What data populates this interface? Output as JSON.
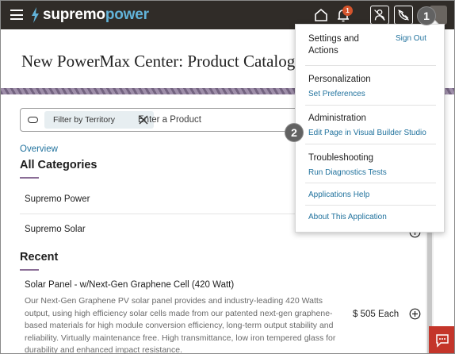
{
  "header": {
    "brand_part1": "supremo",
    "brand_part2": "power",
    "notification_count": "1",
    "brand_colors": {
      "bar": "#302c28",
      "accent": "#62b3d9",
      "badge": "#d4542c"
    }
  },
  "page": {
    "title": "New PowerMax Center: Product Catalog"
  },
  "search": {
    "filter_chip": "Filter by Territory",
    "placeholder": "Enter a Product"
  },
  "overview_link": "Overview",
  "categories": {
    "heading": "All Categories",
    "items": [
      "Supremo Power",
      "Supremo Solar"
    ]
  },
  "recent": {
    "heading": "Recent",
    "product": {
      "name": "Solar Panel - w/Next-Gen Graphene Cell (420 Watt)",
      "description": "Our Next-Gen Graphene PV solar panel provides and industry-leading 420 Watts output, using high efficiency solar cells made from our patented next-gen graphene-based materials for high module conversion efficiency, long-term output stability and reliability. Virtually maintenance free. High transmittance, low iron tempered glass for durability and enhanced impact resistance.",
      "price": "$ 505 Each"
    }
  },
  "menu": {
    "settings_heading": "Settings and Actions",
    "sign_out": "Sign Out",
    "personalization_heading": "Personalization",
    "set_preferences": "Set Preferences",
    "administration_heading": "Administration",
    "edit_page": "Edit Page in Visual Builder Studio",
    "troubleshooting_heading": "Troubleshooting",
    "run_diagnostics": "Run Diagnostics Tests",
    "applications_help": "Applications Help",
    "about": "About This Application"
  },
  "callouts": [
    "1",
    "2"
  ],
  "icons": [
    "hamburger-icon",
    "bolt-icon",
    "home-icon",
    "bell-icon",
    "user-x-icon",
    "phone-off-icon",
    "filter-toggle-icon",
    "close-icon",
    "add-circle-icon",
    "chat-icon"
  ]
}
